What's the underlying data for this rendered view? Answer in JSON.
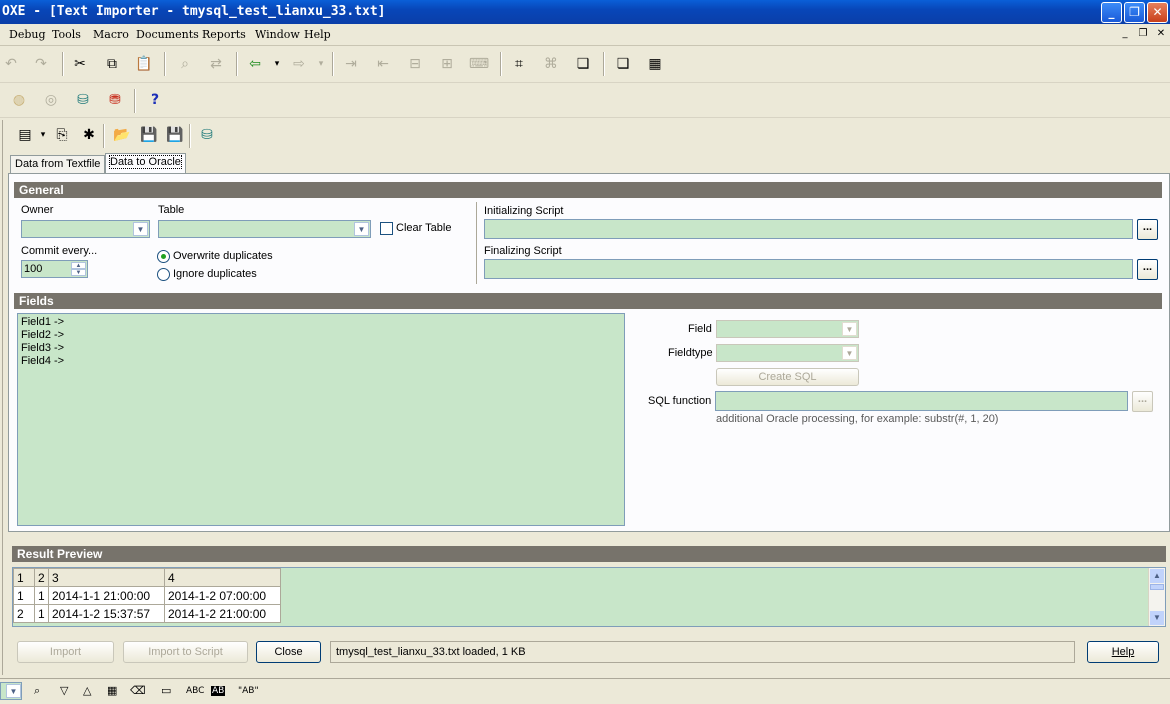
{
  "window": {
    "title": "OXE - [Text Importer - tmysql_test_lianxu_33.txt]",
    "minimize_glyph": "_",
    "restore_glyph": "❐",
    "close_glyph": "✕"
  },
  "menu": {
    "items": [
      "Debug",
      "Tools",
      "Macro",
      "Documents",
      "Reports",
      "Window",
      "Help"
    ],
    "mdi_minimize": "_",
    "mdi_restore": "❐",
    "mdi_close": "✕"
  },
  "toolbar1": {
    "icons": [
      "undo-icon",
      "redo-icon",
      "cut-icon",
      "copy-icon",
      "paste-icon",
      "find-icon",
      "replace-icon",
      "load-icon",
      "execute-icon",
      "indent-icon",
      "unindent-icon",
      "comment-icon",
      "uncomment-icon",
      "explain-icon",
      "trace-icon",
      "describe-icon",
      "windows-icon",
      "tile-icon"
    ],
    "glyphs": [
      "↶",
      "↷",
      "✂",
      "⧉",
      "📋",
      "⌕",
      "⇄",
      "⇦",
      "⇨",
      "⇥",
      "⇤",
      "⊟",
      "⊞",
      "⌨",
      "⌗",
      "⌘",
      "❏",
      "▦"
    ]
  },
  "toolbar2": {
    "icons": [
      "db-connect-icon",
      "sql-icon",
      "db-icon",
      "db-refresh-icon",
      "help-icon"
    ],
    "glyphs": [
      "◍",
      "◎",
      "⛁",
      "⛃",
      "?"
    ]
  },
  "toolbar3": {
    "icons": [
      "open-icon",
      "dropdown-arrow-icon",
      "paste-template-icon",
      "new-icon",
      "folder-open-icon",
      "save-icon",
      "save-as-icon",
      "database-icon"
    ],
    "glyphs": [
      "▤",
      "▾",
      "⎘",
      "✱",
      "📂",
      "💾",
      "💾",
      "⛁"
    ]
  },
  "tabs": [
    "Data from Textfile",
    "Data to Oracle"
  ],
  "general": {
    "header": "General",
    "owner_label": "Owner",
    "owner_value": "",
    "table_label": "Table",
    "table_value": "",
    "clear_table_label": "Clear Table",
    "clear_table_checked": false,
    "commit_label": "Commit every...",
    "commit_value": "100",
    "overwrite_label": "Overwrite duplicates",
    "ignore_label": "Ignore duplicates",
    "selected_duplicate_mode": "overwrite",
    "init_script_label": "Initializing Script",
    "init_script_value": "",
    "final_script_label": "Finalizing Script",
    "final_script_value": "",
    "browse_button": "..."
  },
  "fields": {
    "header": "Fields",
    "list": [
      "Field1  ->",
      "Field2  ->",
      "Field3  ->",
      "Field4  ->"
    ],
    "field_label": "Field",
    "fieldtype_label": "Fieldtype",
    "create_sql_button": "Create SQL",
    "sql_function_label": "SQL function",
    "sql_function_value": "",
    "sql_hint": "additional Oracle processing, for example: substr(#, 1, 20)",
    "browse_button": "..."
  },
  "result_preview": {
    "header": "Result Preview",
    "columns": [
      "1",
      "2",
      "3",
      "4"
    ],
    "rows": [
      [
        "1",
        "1",
        "2014-1-1 21:00:00",
        "2014-1-2 07:00:00"
      ],
      [
        "2",
        "1",
        "2014-1-2 15:37:57",
        "2014-1-2 21:00:00"
      ]
    ]
  },
  "buttons": {
    "import": "Import",
    "import_to_script": "Import to Script",
    "close": "Close",
    "help": "Help"
  },
  "status_message": "tmysql_test_lianxu_33.txt loaded,  1 KB",
  "statusbar": {
    "icons": [
      "binoculars-icon",
      "triangle-down-icon",
      "triangle-up-icon",
      "grid-icon",
      "eraser-icon",
      "window-icon",
      "abc-icon",
      "abc-highlight-icon",
      "quote-ab-icon"
    ],
    "glyphs": [
      "⌕",
      "▽",
      "△",
      "▦",
      "⌫",
      "▭",
      "ABC",
      "AB",
      "\"AB\""
    ]
  }
}
